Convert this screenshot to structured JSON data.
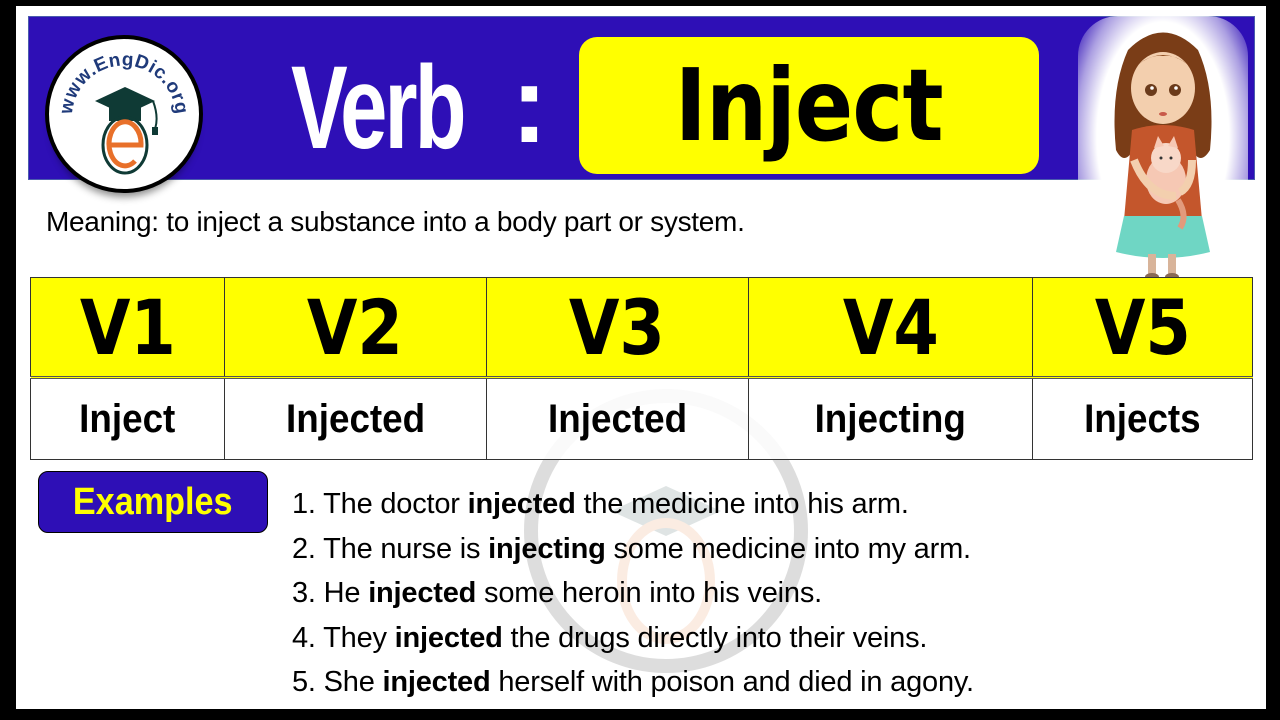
{
  "header": {
    "logo_text": "www.EngDic.org",
    "label": "Verb",
    "separator": ":",
    "word": "Inject"
  },
  "meaning": "Meaning: to inject a substance into a body part or system.",
  "table": {
    "headers": [
      "V1",
      "V2",
      "V3",
      "V4",
      "V5"
    ],
    "forms": [
      "Inject",
      "Injected",
      "Injected",
      "Injecting",
      "Injects"
    ]
  },
  "examples": {
    "label": "Examples",
    "items": [
      {
        "num": "1.",
        "before": "The doctor",
        "bold": "injected",
        "after": "the medicine into his arm."
      },
      {
        "num": "2.",
        "before": "The nurse is",
        "bold": "injecting",
        "after": "some medicine into my arm."
      },
      {
        "num": "3.",
        "before": "He",
        "bold": "injected",
        "after": "some heroin into his veins."
      },
      {
        "num": "4.",
        "before": "They",
        "bold": "injected",
        "after": "the drugs directly into their veins."
      },
      {
        "num": "5.",
        "before": "She",
        "bold": "injected",
        "after": "herself with poison and died in agony."
      }
    ]
  },
  "colors": {
    "banner": "#2e0fb6",
    "highlight": "#ffff00",
    "logo_accent": "#e8702a",
    "logo_text": "#1f3a7a"
  }
}
